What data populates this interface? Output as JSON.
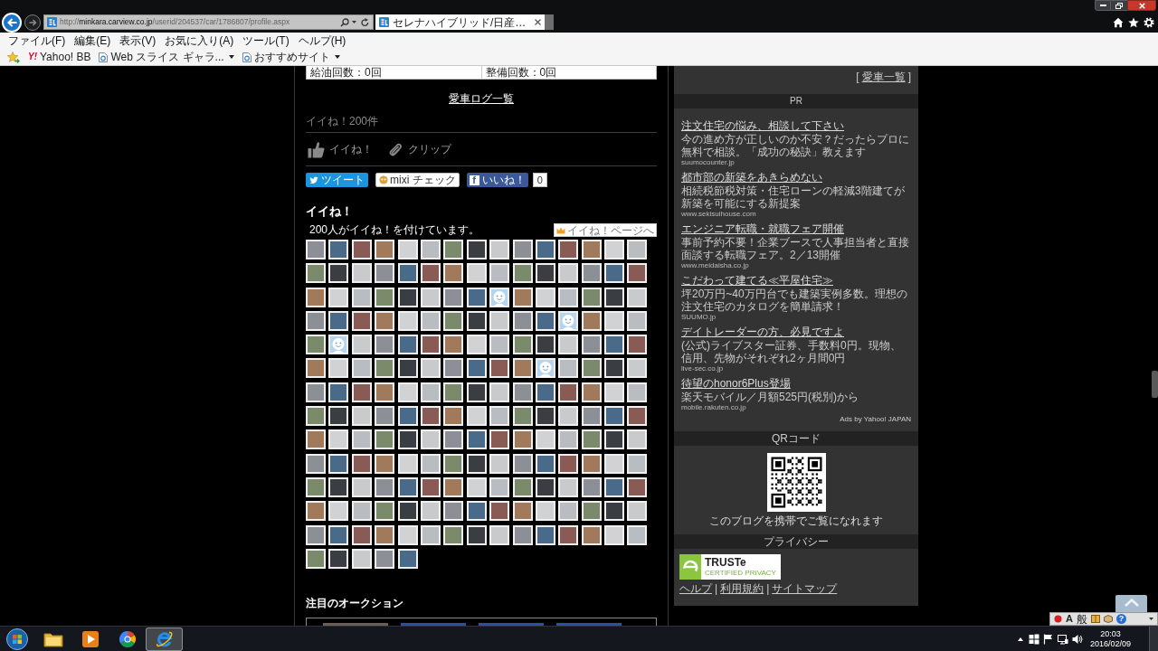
{
  "browser": {
    "address": "http://**minkara.carview.co.jp**/userid/204537/car/1786807/profile.aspx",
    "tabs": [
      {
        "title": "セレナハイブリッド/日産…",
        "selected": true
      }
    ],
    "menu": [
      "ファイル(F)",
      "編集(E)",
      "表示(V)",
      "お気に入り(A)",
      "ツール(T)",
      "ヘルプ(H)"
    ],
    "favorites": [
      {
        "kind": "yahoo",
        "badge": "Y!",
        "label": "Yahoo! BB",
        "dropdown": false
      },
      {
        "kind": "page",
        "label": "Web スライス ギャラ...",
        "dropdown": true
      },
      {
        "kind": "page",
        "label": "おすすめサイト",
        "dropdown": true
      }
    ]
  },
  "profile": {
    "stats": [
      "給油回数：0回",
      "整備回数：0回"
    ],
    "log_link": "愛車ログ一覧",
    "like_total": "イイね！200件",
    "actions": [
      {
        "kind": "like",
        "label": "イイね！"
      },
      {
        "kind": "clip",
        "label": "クリップ"
      }
    ],
    "share": [
      {
        "kind": "twitter",
        "label": "ツイート"
      },
      {
        "kind": "mixi",
        "label": "mixi チェック"
      },
      {
        "kind": "facebook",
        "logo": "f",
        "label": "いいね！",
        "count": "0"
      }
    ]
  },
  "likes": {
    "heading": "イイね！",
    "summary": "200人がイイね！を付けています。",
    "page_link": "イイね！ページへ",
    "people": [
      {
        "kind": "photo"
      },
      {
        "kind": "photo"
      },
      {
        "kind": "photo"
      },
      {
        "kind": "photo"
      },
      {
        "kind": "photo"
      },
      {
        "kind": "photo"
      },
      {
        "kind": "photo"
      },
      {
        "kind": "photo"
      },
      {
        "kind": "photo"
      },
      {
        "kind": "photo"
      },
      {
        "kind": "photo"
      },
      {
        "kind": "photo"
      },
      {
        "kind": "photo"
      },
      {
        "kind": "photo"
      },
      {
        "kind": "photo"
      },
      {
        "kind": "photo"
      },
      {
        "kind": "photo"
      },
      {
        "kind": "photo"
      },
      {
        "kind": "photo"
      },
      {
        "kind": "photo"
      },
      {
        "kind": "photo"
      },
      {
        "kind": "photo"
      },
      {
        "kind": "photo"
      },
      {
        "kind": "photo"
      },
      {
        "kind": "photo"
      },
      {
        "kind": "photo"
      },
      {
        "kind": "photo"
      },
      {
        "kind": "photo"
      },
      {
        "kind": "photo"
      },
      {
        "kind": "photo"
      },
      {
        "kind": "photo"
      },
      {
        "kind": "photo"
      },
      {
        "kind": "photo"
      },
      {
        "kind": "photo"
      },
      {
        "kind": "photo"
      },
      {
        "kind": "photo"
      },
      {
        "kind": "photo"
      },
      {
        "kind": "photo"
      },
      {
        "kind": "avatar"
      },
      {
        "kind": "photo"
      },
      {
        "kind": "photo"
      },
      {
        "kind": "photo"
      },
      {
        "kind": "photo"
      },
      {
        "kind": "photo"
      },
      {
        "kind": "photo"
      },
      {
        "kind": "photo"
      },
      {
        "kind": "photo"
      },
      {
        "kind": "photo"
      },
      {
        "kind": "photo"
      },
      {
        "kind": "photo"
      },
      {
        "kind": "photo"
      },
      {
        "kind": "photo"
      },
      {
        "kind": "photo"
      },
      {
        "kind": "photo"
      },
      {
        "kind": "photo"
      },
      {
        "kind": "photo"
      },
      {
        "kind": "avatar"
      },
      {
        "kind": "photo"
      },
      {
        "kind": "photo"
      },
      {
        "kind": "photo"
      },
      {
        "kind": "photo"
      },
      {
        "kind": "avatar"
      },
      {
        "kind": "photo"
      },
      {
        "kind": "photo"
      },
      {
        "kind": "photo"
      },
      {
        "kind": "photo"
      },
      {
        "kind": "photo"
      },
      {
        "kind": "photo"
      },
      {
        "kind": "photo"
      },
      {
        "kind": "photo"
      },
      {
        "kind": "photo"
      },
      {
        "kind": "photo"
      },
      {
        "kind": "photo"
      },
      {
        "kind": "photo"
      },
      {
        "kind": "photo"
      },
      {
        "kind": "photo"
      },
      {
        "kind": "photo"
      },
      {
        "kind": "photo"
      },
      {
        "kind": "photo"
      },
      {
        "kind": "photo"
      },
      {
        "kind": "photo"
      },
      {
        "kind": "photo"
      },
      {
        "kind": "photo"
      },
      {
        "kind": "photo"
      },
      {
        "kind": "photo"
      },
      {
        "kind": "avatar"
      },
      {
        "kind": "photo"
      },
      {
        "kind": "photo"
      },
      {
        "kind": "photo"
      },
      {
        "kind": "photo"
      },
      {
        "kind": "photo"
      },
      {
        "kind": "photo"
      },
      {
        "kind": "photo"
      },
      {
        "kind": "photo"
      },
      {
        "kind": "photo"
      },
      {
        "kind": "photo"
      },
      {
        "kind": "photo"
      },
      {
        "kind": "photo"
      },
      {
        "kind": "photo"
      },
      {
        "kind": "photo"
      },
      {
        "kind": "photo"
      },
      {
        "kind": "photo"
      },
      {
        "kind": "photo"
      },
      {
        "kind": "photo"
      },
      {
        "kind": "photo"
      },
      {
        "kind": "photo"
      },
      {
        "kind": "photo"
      },
      {
        "kind": "photo"
      },
      {
        "kind": "photo"
      },
      {
        "kind": "photo"
      },
      {
        "kind": "photo"
      },
      {
        "kind": "photo"
      },
      {
        "kind": "photo"
      },
      {
        "kind": "photo"
      },
      {
        "kind": "photo"
      },
      {
        "kind": "photo"
      },
      {
        "kind": "photo"
      },
      {
        "kind": "photo"
      },
      {
        "kind": "photo"
      },
      {
        "kind": "photo"
      },
      {
        "kind": "photo"
      },
      {
        "kind": "photo"
      },
      {
        "kind": "photo"
      },
      {
        "kind": "photo"
      },
      {
        "kind": "photo"
      },
      {
        "kind": "photo"
      },
      {
        "kind": "photo"
      },
      {
        "kind": "photo"
      },
      {
        "kind": "photo"
      },
      {
        "kind": "photo"
      },
      {
        "kind": "photo"
      },
      {
        "kind": "photo"
      },
      {
        "kind": "photo"
      },
      {
        "kind": "photo"
      },
      {
        "kind": "photo"
      },
      {
        "kind": "photo"
      },
      {
        "kind": "photo"
      },
      {
        "kind": "photo"
      },
      {
        "kind": "photo"
      },
      {
        "kind": "photo"
      },
      {
        "kind": "photo"
      },
      {
        "kind": "photo"
      },
      {
        "kind": "photo"
      },
      {
        "kind": "photo"
      },
      {
        "kind": "photo"
      },
      {
        "kind": "photo"
      },
      {
        "kind": "photo"
      },
      {
        "kind": "photo"
      },
      {
        "kind": "photo"
      },
      {
        "kind": "photo"
      },
      {
        "kind": "photo"
      },
      {
        "kind": "photo"
      },
      {
        "kind": "photo"
      },
      {
        "kind": "photo"
      },
      {
        "kind": "photo"
      },
      {
        "kind": "photo"
      },
      {
        "kind": "photo"
      },
      {
        "kind": "photo"
      },
      {
        "kind": "photo"
      },
      {
        "kind": "photo"
      },
      {
        "kind": "photo"
      },
      {
        "kind": "photo"
      },
      {
        "kind": "photo"
      },
      {
        "kind": "photo"
      },
      {
        "kind": "photo"
      },
      {
        "kind": "photo"
      },
      {
        "kind": "photo"
      },
      {
        "kind": "photo"
      },
      {
        "kind": "photo"
      },
      {
        "kind": "photo"
      },
      {
        "kind": "photo"
      },
      {
        "kind": "photo"
      },
      {
        "kind": "photo"
      },
      {
        "kind": "photo"
      },
      {
        "kind": "photo"
      },
      {
        "kind": "photo"
      },
      {
        "kind": "photo"
      },
      {
        "kind": "photo"
      },
      {
        "kind": "photo"
      },
      {
        "kind": "photo"
      },
      {
        "kind": "photo"
      },
      {
        "kind": "photo"
      },
      {
        "kind": "photo"
      },
      {
        "kind": "photo"
      },
      {
        "kind": "photo"
      },
      {
        "kind": "photo"
      },
      {
        "kind": "photo"
      },
      {
        "kind": "photo"
      },
      {
        "kind": "photo"
      },
      {
        "kind": "photo"
      },
      {
        "kind": "photo"
      },
      {
        "kind": "photo"
      },
      {
        "kind": "photo"
      },
      {
        "kind": "photo"
      },
      {
        "kind": "photo"
      },
      {
        "kind": "photo"
      },
      {
        "kind": "photo"
      },
      {
        "kind": "photo"
      },
      {
        "kind": "photo"
      },
      {
        "kind": "photo"
      }
    ]
  },
  "auction": {
    "heading": "注目のオークション",
    "items": [
      {
        "kind": "photo"
      },
      {
        "kind": "photo"
      },
      {
        "kind": "photo"
      },
      {
        "kind": "photo"
      }
    ]
  },
  "sidebar": {
    "car_list": {
      "before": "[",
      "label": "愛車一覧",
      "after": "]"
    },
    "pr": {
      "title": "PR",
      "ads": [
        {
          "title": "注文住宅の悩み、相談して下さい",
          "text": "今の進め方が正しいのか不安？だったらプロに無料で相談。「成功の秘訣」教えます",
          "domain": "suumocounter.jp"
        },
        {
          "title": "都市部の新築をあきらめない",
          "text": "相続税節税対策・住宅ローンの軽減3階建てが新築を可能にする新提案",
          "domain": "www.sekisuihouse.com"
        },
        {
          "title": "エンジニア転職・就職フェア開催",
          "text": "事前予約不要！企業ブースで人事担当者と直接面談する転職フェア。2／13開催",
          "domain": "www.meidaisha.co.jp"
        },
        {
          "title": "こだわって建てる≪平屋住宅≫",
          "text": "坪20万円~40万円台でも建築実例多数。理想の注文住宅のカタログを簡単請求！",
          "domain": "SUUMO.jp"
        },
        {
          "title": "デイトレーダーの方、必見ですよ",
          "text": "(公式)ライブスター証券、手数料0円。現物、信用、先物がそれぞれ2ヶ月間0円",
          "domain": "live-sec.co.jp"
        },
        {
          "title": "待望のhonor6Plus登場",
          "text": "楽天モバイル／月額525円(税別)から",
          "domain": "mobile.rakuten.co.jp"
        }
      ],
      "credit": "Ads by Yahoo! JAPAN"
    },
    "qr": {
      "title": "QRコード",
      "caption": "このブログを携帯でご覧になれます"
    },
    "privacy": {
      "title": "プライバシー",
      "seal": {
        "name": "TRUSTe",
        "tagline": "CERTIFIED PRIVACY"
      },
      "links": [
        {
          "label": "ヘルプ",
          "separator": "|"
        },
        {
          "label": "利用規約",
          "separator": "|"
        },
        {
          "label": "サイトマップ"
        }
      ]
    }
  },
  "language_bar": {
    "mode": "A",
    "input": "般",
    "help": "?"
  },
  "taskbar": {
    "apps": [
      {
        "kind": "explorer",
        "selected": false
      },
      {
        "kind": "media",
        "selected": false
      },
      {
        "kind": "chrome",
        "selected": false
      },
      {
        "kind": "ie",
        "selected": true
      }
    ],
    "time": "20:03",
    "date": "2016/02/09"
  }
}
